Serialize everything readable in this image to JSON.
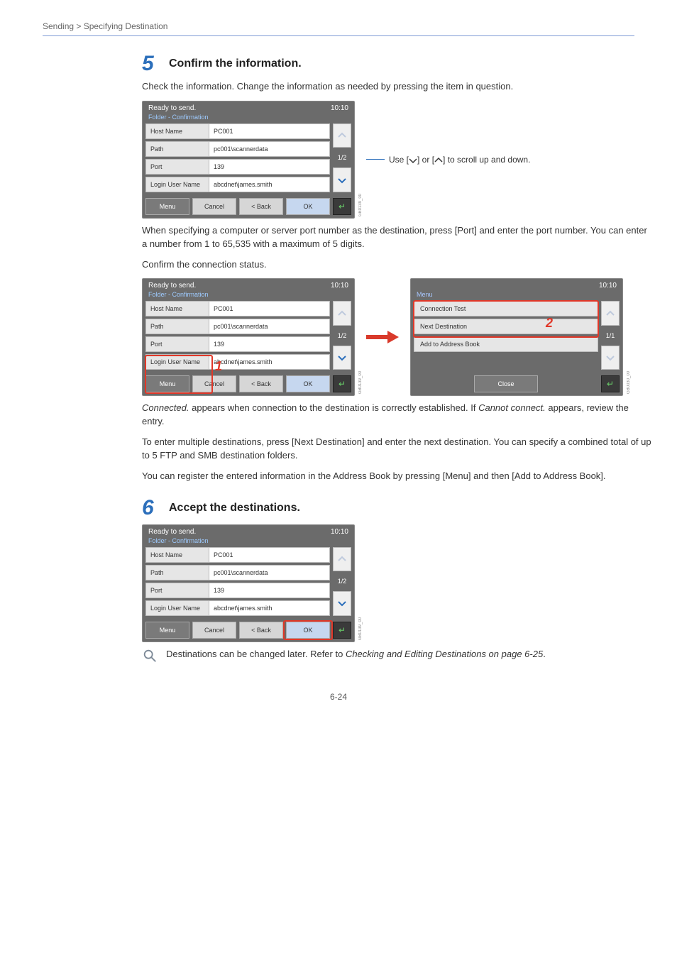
{
  "breadcrumb": "Sending > Specifying Destination",
  "step5": {
    "number": "5",
    "title": "Confirm the information.",
    "prologue": "Check the information. Change the information as needed by pressing the item in question.",
    "scroll_hint_prefix": "Use [",
    "scroll_hint_mid": "] or [",
    "scroll_hint_suffix": "] to scroll up and down.",
    "port_note": "When specifying a computer or server port number as the destination, press [Port] and enter the port number. You can enter a number from 1 to 65,535 with a maximum of 5 digits.",
    "confirm_status": "Confirm the connection status.",
    "connected_note_1": "Connected.",
    "connected_note_2": " appears when connection to the destination is correctly established. If ",
    "connected_note_3": "Cannot connect.",
    "connected_note_4": " appears, review the entry.",
    "multi_dest": "To enter multiple destinations, press [Next Destination] and enter the next destination. You can specify a combined total of up to 5 FTP and SMB destination folders.",
    "register_note": "You can register the entered information in the Address Book by pressing [Menu] and then [Add to Address Book]."
  },
  "step6": {
    "number": "6",
    "title": "Accept the destinations.",
    "note_prefix": "Destinations can be changed later. Refer to ",
    "note_link": "Checking and Editing Destinations on page 6-25",
    "note_suffix": "."
  },
  "panel_common": {
    "ready": "Ready to send.",
    "clock": "10:10",
    "sub": "Folder - Confirmation",
    "page_ind": "1/2",
    "menu_btn": "Menu",
    "cancel_btn": "Cancel",
    "back_btn": "< Back",
    "ok_btn": "OK",
    "gcode": "GB0139_00",
    "fields": {
      "host_label": "Host Name",
      "host_value": "PC001",
      "path_label": "Path",
      "path_value": "pc001\\scannerdata",
      "port_label": "Port",
      "port_value": "139",
      "login_label": "Login User Name",
      "login_value": "abcdnet\\james.smith"
    }
  },
  "menu_panel": {
    "clock": "10:10",
    "sub": "Menu",
    "page_ind": "1/1",
    "items": {
      "conn_test": "Connection Test",
      "next_dest": "Next Destination",
      "add_ab": "Add to Address Book"
    },
    "close_btn": "Close",
    "gcode": "GB0030_00"
  },
  "callouts": {
    "one": "1",
    "two": "2"
  },
  "page_number": "6-24"
}
